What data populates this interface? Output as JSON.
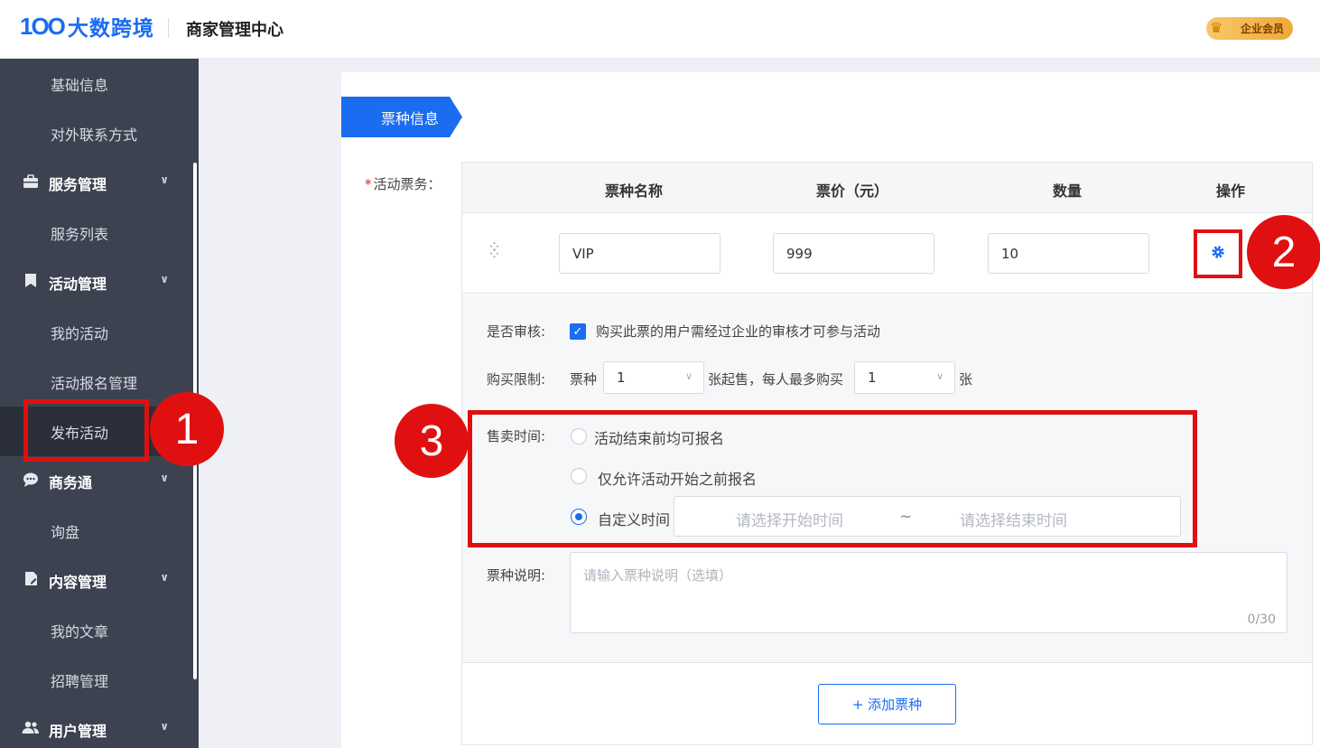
{
  "header": {
    "logo_mark": "1OO",
    "logo_text": "大数跨境",
    "title": "商家管理中心",
    "vip_label": "企业会员"
  },
  "sidebar": {
    "items": [
      {
        "label": "基础信息",
        "type": "sub"
      },
      {
        "label": "对外联系方式",
        "type": "sub"
      },
      {
        "label": "服务管理",
        "type": "group",
        "icon": "briefcase-icon"
      },
      {
        "label": "服务列表",
        "type": "sub"
      },
      {
        "label": "活动管理",
        "type": "group",
        "icon": "bookmark-icon"
      },
      {
        "label": "我的活动",
        "type": "sub"
      },
      {
        "label": "活动报名管理",
        "type": "sub"
      },
      {
        "label": "发布活动",
        "type": "sub",
        "active": true
      },
      {
        "label": "商务通",
        "type": "group",
        "icon": "chat-icon"
      },
      {
        "label": "询盘",
        "type": "sub"
      },
      {
        "label": "内容管理",
        "type": "group",
        "icon": "document-icon"
      },
      {
        "label": "我的文章",
        "type": "sub"
      },
      {
        "label": "招聘管理",
        "type": "sub"
      },
      {
        "label": "用户管理",
        "type": "group",
        "icon": "users-icon"
      }
    ]
  },
  "section": {
    "tag": "票种信息",
    "field_label": "活动票务："
  },
  "table": {
    "headers": [
      "票种名称",
      "票价（元）",
      "数量",
      "操作"
    ],
    "row": {
      "name": "VIP",
      "price": "999",
      "quantity": "10"
    }
  },
  "detail": {
    "review_label": "是否审核:",
    "review_text": "购买此票的用户需经过企业的审核才可参与活动",
    "limit_label": "购买限制:",
    "limit_prefix": "票种",
    "limit_min": "1",
    "limit_mid": "张起售，每人最多购买",
    "limit_max": "1",
    "limit_suffix": "张",
    "sale_label": "售卖时间:",
    "sale_options": [
      "活动结束前均可报名",
      "仅允许活动开始之前报名",
      "自定义时间"
    ],
    "sale_selected": 2,
    "start_placeholder": "请选择开始时间",
    "range_sep": "~",
    "end_placeholder": "请选择结束时间",
    "desc_label": "票种说明:",
    "desc_placeholder": "请输入票种说明（选填）",
    "desc_counter": "0/30"
  },
  "add_button": "+ 添加票种",
  "annotations": [
    "1",
    "2",
    "3"
  ],
  "colors": {
    "accent": "#1a6cf0",
    "sidebar": "#3d4251",
    "annotation": "#e01010"
  }
}
